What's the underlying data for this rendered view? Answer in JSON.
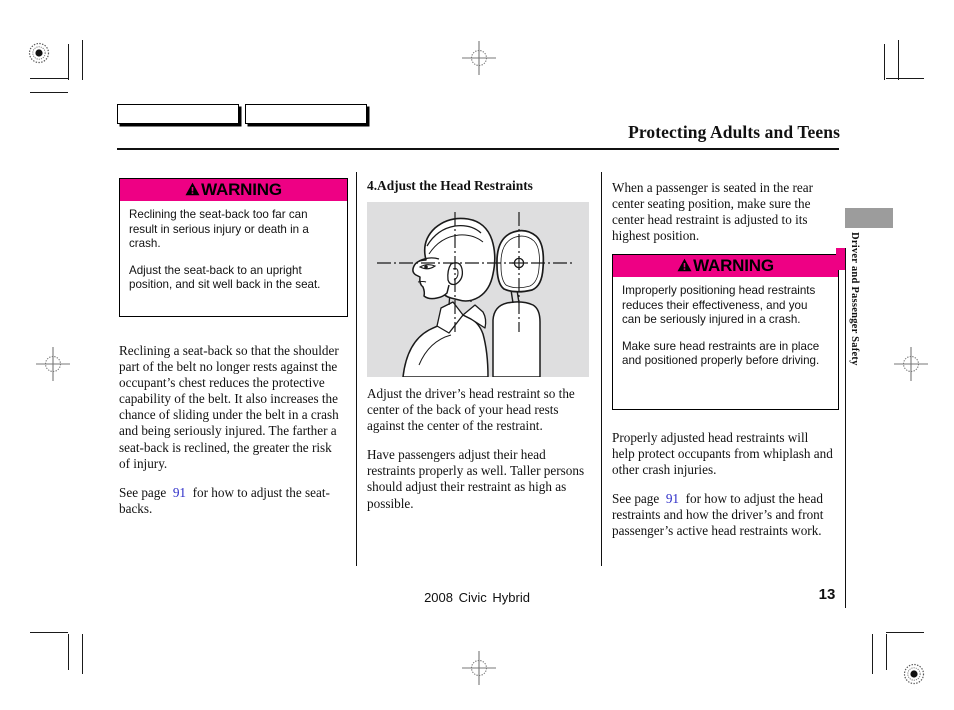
{
  "page": {
    "title": "Protecting Adults and Teens",
    "footer_model": "2008  Civic  Hybrid",
    "page_number": "13",
    "side_tab_label": "Driver and Passenger Safety"
  },
  "colors": {
    "warning_magenta": "#ee0084",
    "page_reference_blue": "#2b2bc8",
    "figure_background": "#dededf",
    "side_tab_gray": "#9c9c9c"
  },
  "left_column": {
    "warning": {
      "heading": "WARNING",
      "icon": "warning-triangle-icon",
      "paragraphs": [
        "Reclining the seat-back too far can result in serious injury or death in a crash.",
        "Adjust the seat-back to an upright position, and sit well back in the seat."
      ]
    },
    "body": {
      "paragraph_1": "Reclining a seat-back so that the shoulder part of the belt no longer rests against the occupant’s chest reduces the protective capability of the belt. It also increases the chance of sliding under the belt in a crash and being seriously injured. The farther a seat-back is reclined, the greater the risk of injury.",
      "see_page_prefix": "See page",
      "see_page_number": "91",
      "see_page_suffix": "for how to adjust the seat-backs."
    }
  },
  "middle_column": {
    "subheading": "4.Adjust the Head Restraints",
    "figure_alt": "head-restraint-adjustment-illustration",
    "body": {
      "paragraph_1": "Adjust the driver’s head restraint so the center of the back of your head rests against the center of the restraint.",
      "paragraph_2": "Have passengers adjust their head restraints properly as well. Taller persons should adjust their restraint as high as possible."
    }
  },
  "right_column": {
    "intro": "When a passenger is seated in the rear center seating position, make sure the center head restraint is adjusted to its highest position.",
    "warning": {
      "heading": "WARNING",
      "icon": "warning-triangle-icon",
      "paragraphs": [
        "Improperly positioning head restraints reduces their effectiveness, and you can be seriously injured in a crash.",
        "Make sure head restraints are in place and positioned properly before driving."
      ]
    },
    "body": {
      "paragraph_1": "Properly adjusted head restraints will help protect occupants from whiplash and other crash injuries.",
      "see_page_prefix": "See page",
      "see_page_number": "91",
      "see_page_suffix": "for how to adjust the head restraints and how the driver’s and front passenger’s active head restraints work."
    }
  }
}
